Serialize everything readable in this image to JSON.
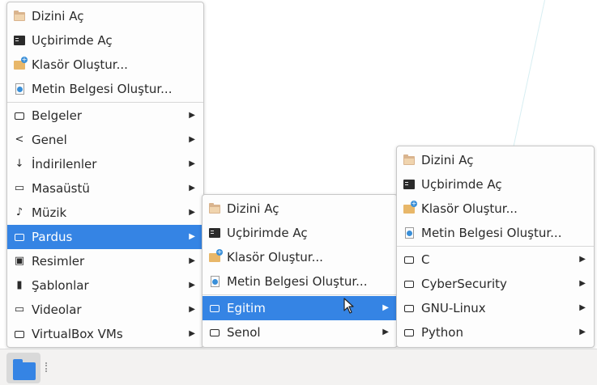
{
  "file_actions": {
    "open_folder": "Dizini Aç",
    "open_terminal": "Uçbirimde Aç",
    "create_folder": "Klasör Oluştur...",
    "create_document": "Metin Belgesi Oluştur..."
  },
  "menu1": {
    "folders": [
      {
        "label": "Belgeler",
        "icon": "folder-outline-icon"
      },
      {
        "label": "Genel",
        "icon": "share-icon"
      },
      {
        "label": "İndirilenler",
        "icon": "download-icon"
      },
      {
        "label": "Masaüstü",
        "icon": "desktop-icon"
      },
      {
        "label": "Müzik",
        "icon": "music-icon"
      },
      {
        "label": "Pardus",
        "icon": "folder-outline-icon",
        "highlighted": true
      },
      {
        "label": "Resimler",
        "icon": "image-icon"
      },
      {
        "label": "Şablonlar",
        "icon": "bookmark-icon"
      },
      {
        "label": "Videolar",
        "icon": "video-icon"
      },
      {
        "label": "VirtualBox VMs",
        "icon": "folder-outline-icon"
      }
    ]
  },
  "menu2": {
    "folders": [
      {
        "label": "Egitim",
        "highlighted": true
      },
      {
        "label": "Senol"
      }
    ]
  },
  "menu3": {
    "folders": [
      {
        "label": "C"
      },
      {
        "label": "CyberSecurity"
      },
      {
        "label": "GNU-Linux"
      },
      {
        "label": "Python"
      }
    ]
  },
  "colors": {
    "highlight": "#3584e4",
    "panel": "#f3f2f1"
  }
}
